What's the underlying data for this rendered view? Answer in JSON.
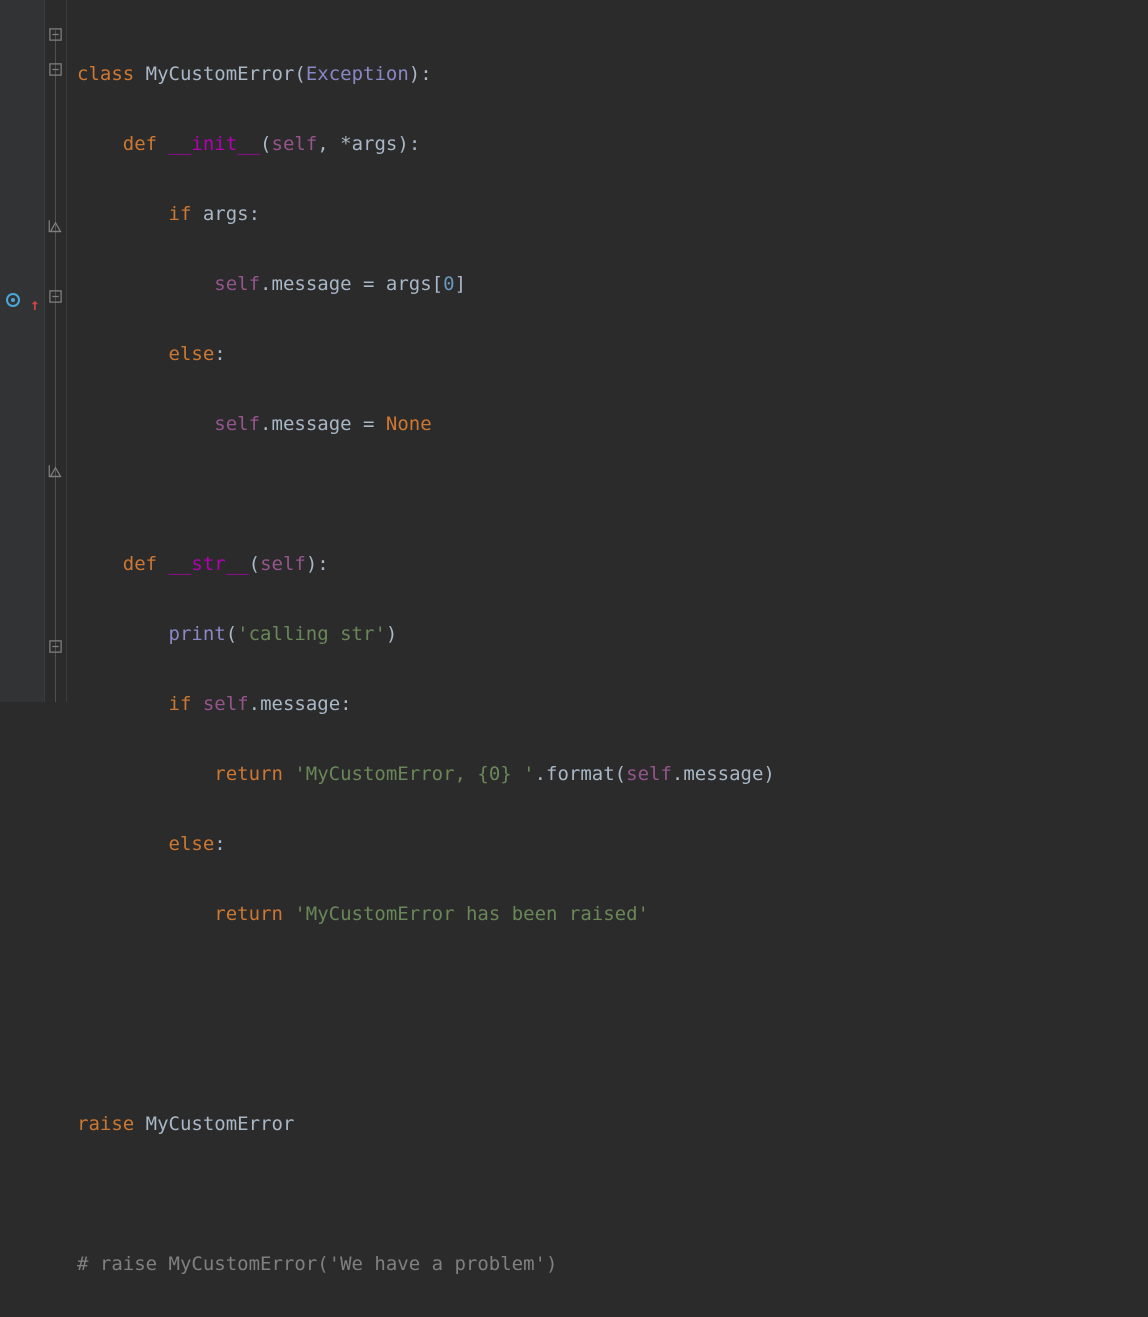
{
  "code": {
    "l1": {
      "class": "class ",
      "name": "MyCustomError",
      "paren_o": "(",
      "base": "Exception",
      "paren_c": ")",
      "colon": ":"
    },
    "l2": {
      "def": "def ",
      "name": "__init__",
      "paren_o": "(",
      "self": "self",
      "comma": ", ",
      "star": "*",
      "args": "args",
      "paren_c": ")",
      "colon": ":"
    },
    "l3": {
      "if": "if ",
      "args": "args",
      "colon": ":"
    },
    "l4": {
      "self": "self",
      "dot": ".",
      "attr": "message ",
      "eq": "= ",
      "args": "args",
      "bracket_o": "[",
      "idx": "0",
      "bracket_c": "]"
    },
    "l5": {
      "else": "else",
      "colon": ":"
    },
    "l6": {
      "self": "self",
      "dot": ".",
      "attr": "message ",
      "eq": "= ",
      "none": "None"
    },
    "l7": {
      "def": "def ",
      "name": "__str__",
      "paren_o": "(",
      "self": "self",
      "paren_c": ")",
      "colon": ":"
    },
    "l8": {
      "print": "print",
      "paren_o": "(",
      "str": "'calling str'",
      "paren_c": ")"
    },
    "l9": {
      "if": "if ",
      "self": "self",
      "dot": ".",
      "attr": "message",
      "colon": ":"
    },
    "l10": {
      "return": "return ",
      "str": "'MyCustomError, {0} '",
      "dot": ".",
      "format": "format",
      "paren_o": "(",
      "self": "self",
      "dot2": ".",
      "attr": "message",
      "paren_c": ")"
    },
    "l11": {
      "else": "else",
      "colon": ":"
    },
    "l12": {
      "return": "return ",
      "str": "'MyCustomError has been raised'"
    },
    "l13": {
      "raise": "raise ",
      "name": "MyCustomError"
    },
    "l14": {
      "comment": "# raise MyCustomError('We have a problem')"
    }
  },
  "colors": {
    "background": "#2b2b2b",
    "gutter": "#313335",
    "keyword": "#cc7832",
    "string": "#6a8759",
    "number": "#6897bb",
    "self": "#94558d",
    "builtin": "#8888c6",
    "fn": "#ffc66d",
    "comment": "#808080"
  }
}
